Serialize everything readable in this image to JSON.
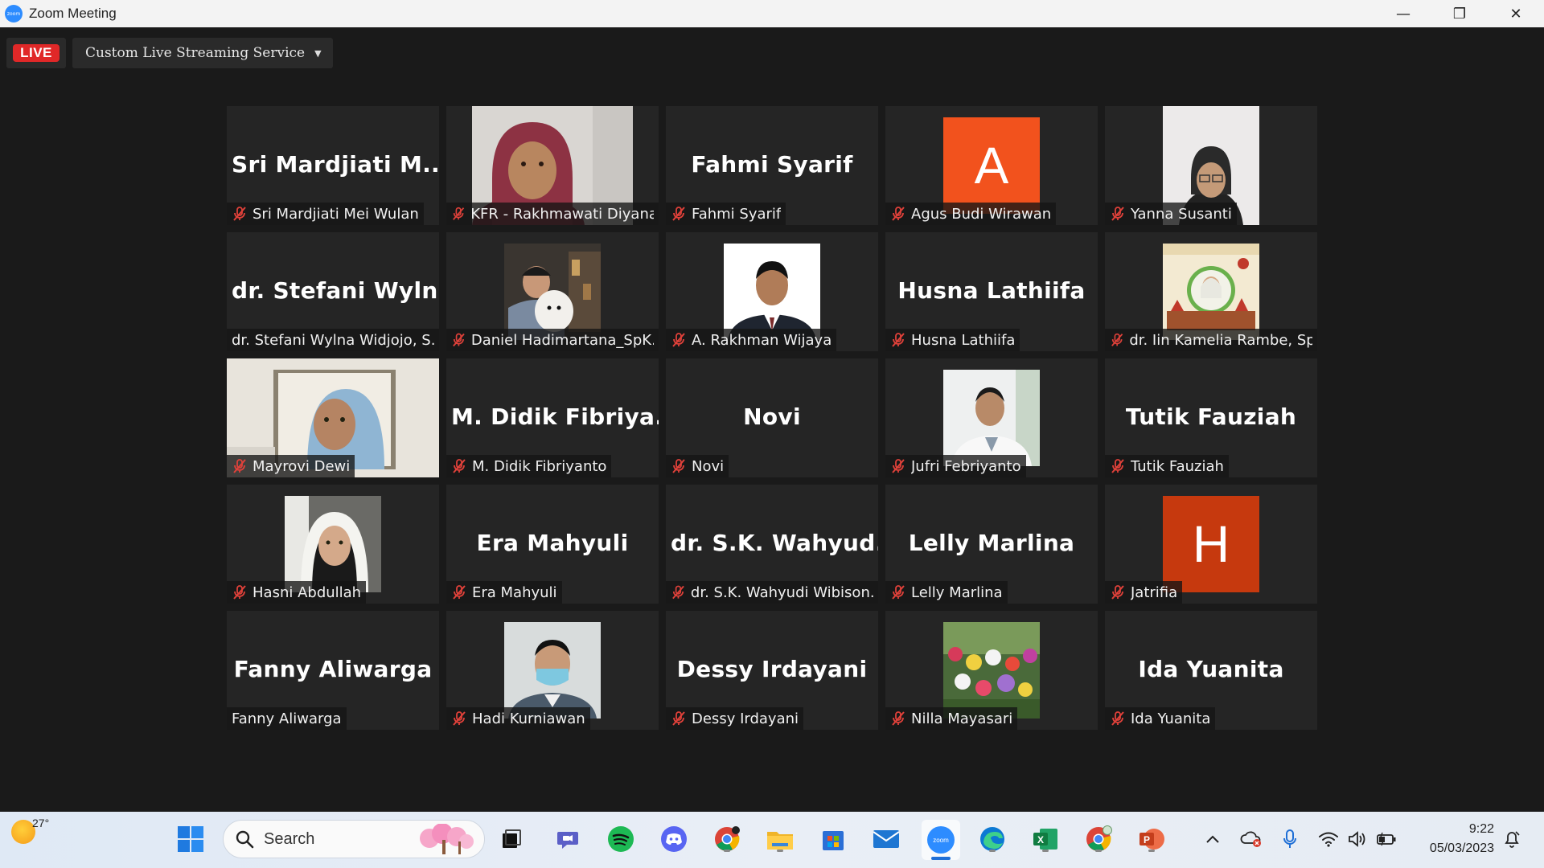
{
  "window": {
    "title": "Zoom Meeting",
    "app_logo_text": "zoom",
    "minimize_glyph": "—",
    "restore_glyph": "❐",
    "close_glyph": "✕"
  },
  "meeting": {
    "live_badge": "LIVE",
    "stream_service": "Custom Live Streaming Service",
    "participants": [
      {
        "display": "Sri  Mardjiati  M...",
        "name": "Sri Mardjiati Mei Wulan",
        "muted": true,
        "type": "text"
      },
      {
        "name": "KFR - Rakhmawati Diyana...",
        "muted": true,
        "type": "video",
        "photo": "woman-hijab-maroon"
      },
      {
        "display": "Fahmi Syarif",
        "name": "Fahmi Syarif",
        "muted": true,
        "type": "text"
      },
      {
        "letter": "A",
        "color": "#f2521d",
        "name": "Agus Budi Wirawan",
        "muted": true,
        "type": "letter"
      },
      {
        "name": "Yanna Susanti",
        "muted": true,
        "type": "video",
        "photo": "woman-glasses"
      },
      {
        "display": "dr.  Stefani  Wyln...",
        "name": "dr. Stefani Wylna Widjojo, S...",
        "muted": false,
        "type": "text"
      },
      {
        "name": "Daniel Hadimartana_SpK...",
        "muted": true,
        "type": "video",
        "photo": "man-with-dog"
      },
      {
        "name": "A. Rakhman Wijaya",
        "muted": true,
        "type": "video",
        "photo": "man-suit"
      },
      {
        "display": "Husna Lathiifa",
        "name": "Husna Lathiifa",
        "muted": true,
        "type": "text"
      },
      {
        "name": "dr. Iin Kamelia Rambe, Sp...",
        "muted": true,
        "type": "video",
        "photo": "poster"
      },
      {
        "name": "Mayrovi Dewi",
        "muted": true,
        "type": "video",
        "photo": "woman-hijab-blue"
      },
      {
        "display": "M.  Didik  Fibriya...",
        "name": "M. Didik Fibriyanto",
        "muted": true,
        "type": "text"
      },
      {
        "display": "Novi",
        "name": "Novi",
        "muted": true,
        "type": "text"
      },
      {
        "name": "Jufri Febriyanto",
        "muted": true,
        "type": "video",
        "photo": "man-white-coat"
      },
      {
        "display": "Tutik Fauziah",
        "name": "Tutik Fauziah",
        "muted": true,
        "type": "text"
      },
      {
        "name": "Hasni Abdullah",
        "muted": true,
        "type": "video",
        "photo": "woman-hijab-white"
      },
      {
        "display": "Era Mahyuli",
        "name": "Era Mahyuli",
        "muted": true,
        "type": "text"
      },
      {
        "display": "dr.  S.K.  Wahyud...",
        "name": "dr. S.K. Wahyudi Wibison...",
        "muted": true,
        "type": "text"
      },
      {
        "display": "Lelly Marlina",
        "name": "Lelly Marlina",
        "muted": true,
        "type": "text"
      },
      {
        "letter": "H",
        "color": "#c6390e",
        "name": "Jatrifia",
        "muted": true,
        "type": "letter"
      },
      {
        "display": "Fanny Aliwarga",
        "name": "Fanny Aliwarga",
        "muted": false,
        "type": "text"
      },
      {
        "name": "Hadi Kurniawan",
        "muted": true,
        "type": "video",
        "photo": "man-mask"
      },
      {
        "display": "Dessy Irdayani",
        "name": "Dessy Irdayani",
        "muted": true,
        "type": "text"
      },
      {
        "name": "Nilla Mayasari",
        "muted": true,
        "type": "video",
        "photo": "tulips"
      },
      {
        "display": "Ida Yuanita",
        "name": "Ida Yuanita",
        "muted": true,
        "type": "text"
      }
    ]
  },
  "taskbar": {
    "weather_temp": "27°",
    "search_label": "Search",
    "time": "9:22",
    "date": "05/03/2023",
    "apps": [
      "start-icon",
      "search-icon",
      "task-view-icon",
      "teams-icon",
      "spotify-icon",
      "discord-icon",
      "chrome-icon",
      "file-explorer-icon",
      "microsoft-store-icon",
      "mail-icon",
      "zoom-icon",
      "edge-icon",
      "excel-icon",
      "chrome-profile-icon",
      "powerpoint-icon"
    ]
  }
}
